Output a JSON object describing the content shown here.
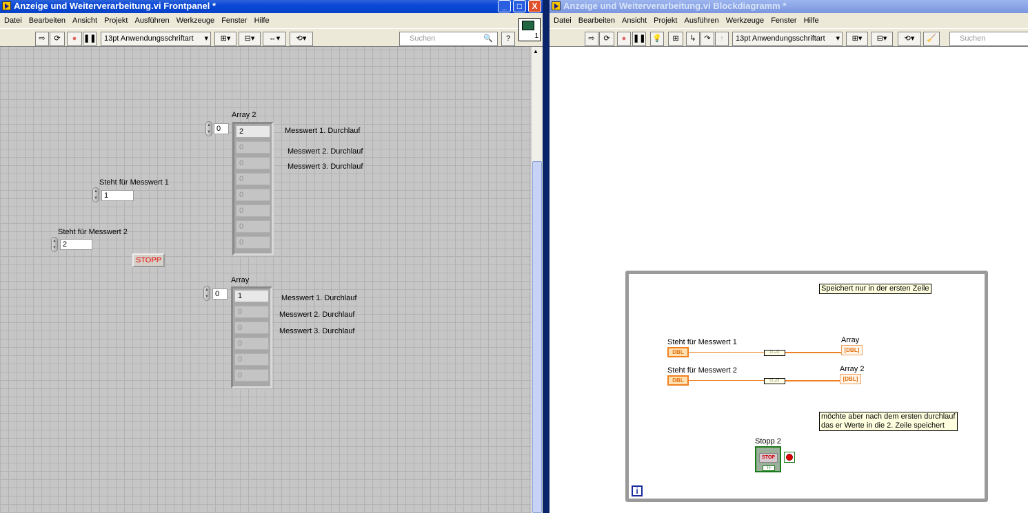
{
  "frontpanel": {
    "title": "Anzeige und Weiterverarbeitung.vi Frontpanel *",
    "window_buttons": {
      "minimize": "_",
      "maximize": "□",
      "close": "X"
    },
    "menu": [
      "Datei",
      "Bearbeiten",
      "Ansicht",
      "Projekt",
      "Ausführen",
      "Werkzeuge",
      "Fenster",
      "Hilfe"
    ],
    "font_select": "13pt Anwendungsschriftart",
    "search_placeholder": "Suchen",
    "help": "?",
    "connector_number": "1",
    "array2": {
      "label": "Array 2",
      "index": "0",
      "values": [
        "2",
        "0",
        "0",
        "0",
        "0",
        "0",
        "0",
        "0"
      ]
    },
    "array2_notes": [
      "Messwert 1. Durchlauf",
      "Messwert 2. Durchlauf",
      "Messwert 3. Durchlauf"
    ],
    "control1": {
      "label": "Steht für Messwert 1",
      "value": "1"
    },
    "control2": {
      "label": "Steht für Messwert 2",
      "value": "2"
    },
    "stop_button": "STOPP",
    "array1": {
      "label": "Array",
      "index": "0",
      "values": [
        "1",
        "0",
        "0",
        "0",
        "0",
        "0"
      ]
    },
    "array1_notes": [
      "Messwert 1. Durchlauf",
      "Messwert 2. Durchlauf",
      "Messwert 3. Durchlauf"
    ]
  },
  "blockdiagram": {
    "title": "Anzeige und Weiterverarbeitung.vi Blockdiagramm *",
    "menu": [
      "Datei",
      "Bearbeiten",
      "Ansicht",
      "Projekt",
      "Ausführen",
      "Werkzeuge",
      "Fenster",
      "Hilfe"
    ],
    "font_select": "13pt Anwendungsschriftart",
    "search_placeholder": "Suchen",
    "note1": "Speichert nur in der ersten Zeile",
    "note2_line1": "möchte aber nach dem ersten durchlauf",
    "note2_line2": "das er Werte in die 2. Zeile speichert",
    "term1_label": "Steht für Messwert 1",
    "term2_label": "Steht für Messwert 2",
    "array_label": "Array",
    "array2_label": "Array 2",
    "dbl": "DBL",
    "dbl_array": "[DBL]",
    "build_array": "□→□",
    "stop_label": "Stopp 2",
    "stop_text": "STOP",
    "tf": "TF",
    "iteration": "i"
  },
  "colors": {
    "wire_orange": "#f08020",
    "loop_border": "#9a9a9a",
    "titlebar_active": "#0a48d6",
    "stop_green": "#1a7a1a"
  }
}
